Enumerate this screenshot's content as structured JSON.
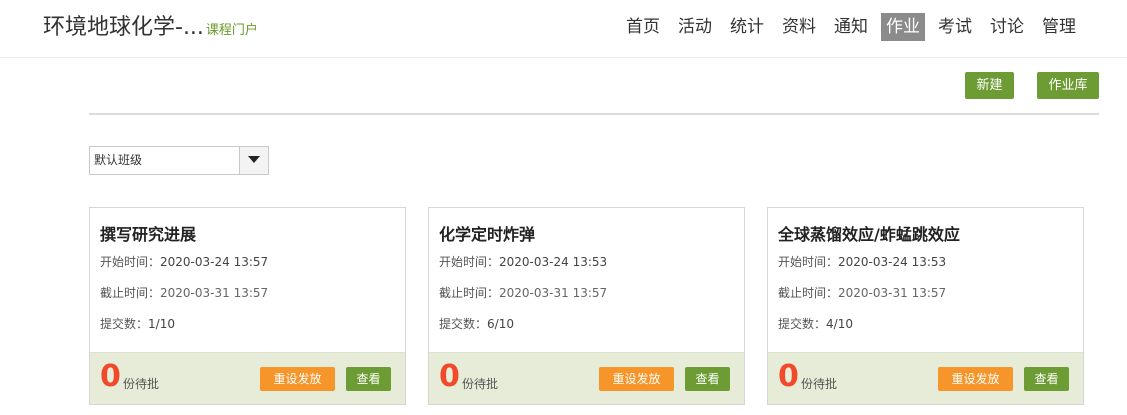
{
  "header": {
    "course_title": "环境地球化学-...",
    "portal_label": "课程门户",
    "nav": [
      "首页",
      "活动",
      "统计",
      "资料",
      "通知",
      "作业",
      "考试",
      "讨论",
      "管理"
    ],
    "active_nav": "作业"
  },
  "toolbar": {
    "new_label": "新建",
    "library_label": "作业库"
  },
  "class_select": {
    "value": "默认班级"
  },
  "cards": [
    {
      "title": "撰写研究进展",
      "start_label": "开始时间：",
      "start": "2020-03-24 13:57",
      "end_label": "截止时间：",
      "end": "2020-03-31 13:57",
      "submit_label": "提交数：",
      "submitted": "1/10",
      "pending": "0",
      "pending_label": "份待批",
      "reset_label": "重设发放",
      "view_label": "查看"
    },
    {
      "title": "化学定时炸弹",
      "start_label": "开始时间：",
      "start": "2020-03-24 13:53",
      "end_label": "截止时间：",
      "end": "2020-03-31 13:57",
      "submit_label": "提交数：",
      "submitted": "6/10",
      "pending": "0",
      "pending_label": "份待批",
      "reset_label": "重设发放",
      "view_label": "查看"
    },
    {
      "title": "全球蒸馏效应/蚱蜢跳效应",
      "start_label": "开始时间：",
      "start": "2020-03-24 13:53",
      "end_label": "截止时间：",
      "end": "2020-03-31 13:57",
      "submit_label": "提交数：",
      "submitted": "4/10",
      "pending": "0",
      "pending_label": "份待批",
      "reset_label": "重设发放",
      "view_label": "查看"
    }
  ],
  "colors": {
    "accent_green": "#6d9c34",
    "orange": "#f5952a",
    "pending_red": "#f04a2a",
    "nav_active_bg": "#8b8b8b"
  }
}
